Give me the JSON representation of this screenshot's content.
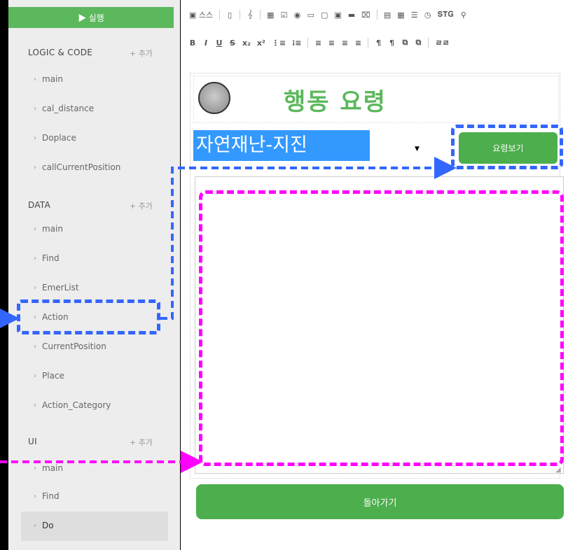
{
  "sidebar": {
    "run_label": "▶ 실행",
    "sections": [
      {
        "title": "LOGIC & CODE",
        "add": "+ 추가",
        "items": [
          "main",
          "cal_distance",
          "Doplace",
          "callCurrentPosition"
        ]
      },
      {
        "title": "DATA",
        "add": "+ 추가",
        "items": [
          "main",
          "Find",
          "EmerList",
          "Action",
          "CurrentPosition",
          "Place",
          "Action_Category"
        ]
      },
      {
        "title": "UI",
        "add": "+ 추가",
        "items": [
          "main",
          "Find",
          "Do"
        ]
      }
    ]
  },
  "toolbar": {
    "row1": [
      "▣ 스스",
      "▯",
      "𝄞",
      "▦",
      "☑",
      "◉",
      "▭",
      "▢",
      "▣",
      "▬",
      "⌧",
      "▤",
      "▦",
      "☰",
      "◷",
      "𝐒𝐓𝐆",
      "⚲"
    ],
    "row2": [
      "B",
      "I",
      "U",
      "S",
      "x₂",
      "x²",
      "⋮≡",
      "⁝≡",
      "≡",
      "≡",
      "≡",
      "≡",
      "¶",
      "¶",
      "⧉",
      "⧉",
      "ㄹㄹ"
    ]
  },
  "form": {
    "title": "행동 요령",
    "select_value": "자연재난-지진",
    "view_button": "요령보기",
    "back_button": "돌아가기"
  },
  "colors": {
    "accent_green": "#5cb85c",
    "annotation_blue": "#3366ff",
    "annotation_magenta": "#ff00ff",
    "select_highlight": "#3399ff"
  }
}
